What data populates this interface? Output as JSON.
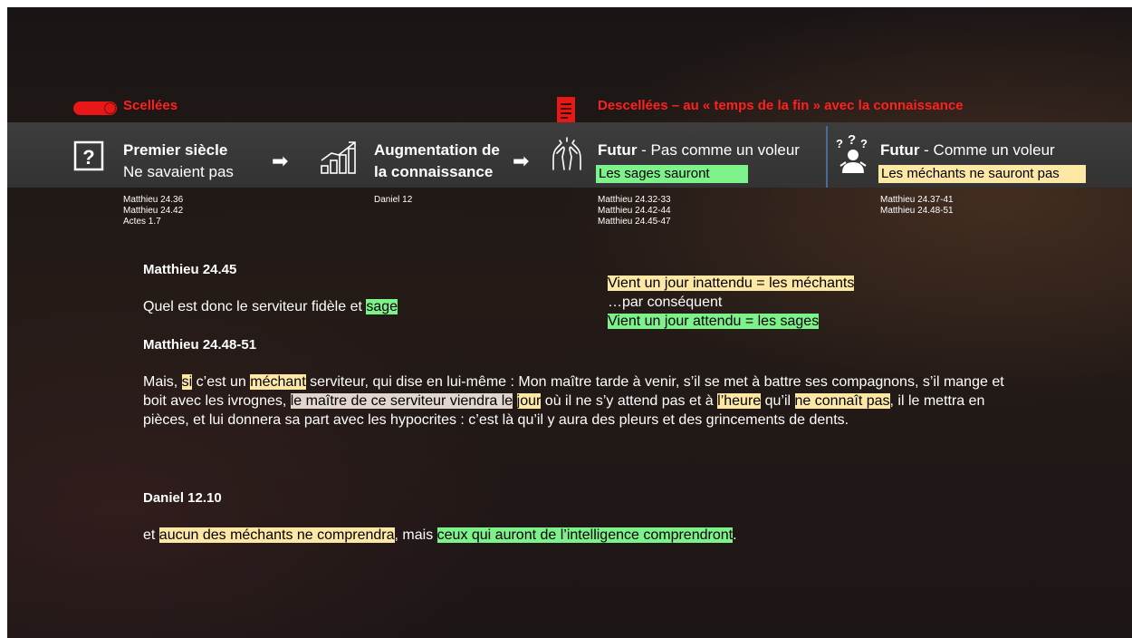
{
  "status": {
    "sealed_label": "Scellées",
    "unsealed_label": "Descellées – au « temps de la fin » avec la connaissance"
  },
  "steps": [
    {
      "icon": "question-box-icon",
      "title_bold": "Premier siècle",
      "subtitle": "Ne savaient pas",
      "refs": [
        "Matthieu 24.36",
        "Matthieu 24.42",
        "Actes 1.7"
      ]
    },
    {
      "icon": "growth-chart-icon",
      "title_line1": "Augmentation de",
      "title_line2": "la connaissance",
      "refs": [
        "Daniel 12"
      ]
    },
    {
      "icon": "open-hands-icon",
      "title_bold": "Futur",
      "title_rest": " - Pas comme un voleur",
      "box": "Les sages sauront",
      "refs": [
        "Matthieu 24.32-33",
        "Matthieu 24.42-44",
        "Matthieu 24.45-47"
      ]
    },
    {
      "icon": "confused-person-icon",
      "title_bold": "Futur",
      "title_rest": " - Comme un voleur",
      "box": "Les méchants ne sauront pas",
      "refs": [
        "Matthieu 24.37-41",
        "Matthieu 24.48-51"
      ]
    }
  ],
  "passage1": {
    "heading": "Matthieu 24.45",
    "text_before": "Quel est donc le serviteur fidèle et ",
    "hl": "sage"
  },
  "contrast": {
    "line1": "Vient un jour inattendu = les méchants",
    "line2": "…par conséquent",
    "line3": "Vient un jour attendu = les sages"
  },
  "passage2": {
    "heading": "Matthieu 24.48-51",
    "p1": "Mais, ",
    "h1": "si",
    "p2": " c’est un ",
    "h2": "méchant",
    "p3": " serviteur, qui dise en lui-même : Mon maître tarde à venir, s’il se met à battre ses compagnons, s’il mange et boit avec les ivrognes, ",
    "h3": "le maître de ce serviteur viendra le",
    "p4": " ",
    "h4": "jour",
    "p5": " où il ne s’y attend pas et à ",
    "h5": "l’heure",
    "p6": " qu’il ",
    "h6": "ne connaît pas",
    "p7": ", il le mettra en pièces, et lui donnera sa part avec les hypocrites : c’est là qu’il y aura des pleurs et des grincements de dents."
  },
  "passage3": {
    "heading": "Daniel 12.10",
    "p1": "et ",
    "h1": "aucun des méchants ne comprendra",
    "p2": ", mais ",
    "h2": "ceux qui auront de l’intelligence comprendront",
    "p3": "."
  },
  "colors": {
    "accent_red": "#ff2020",
    "highlight_green": "#7ef28a",
    "highlight_yellow": "#fde7a4",
    "highlight_grey": "#e0d6cd",
    "band": "#3a3a3a"
  }
}
